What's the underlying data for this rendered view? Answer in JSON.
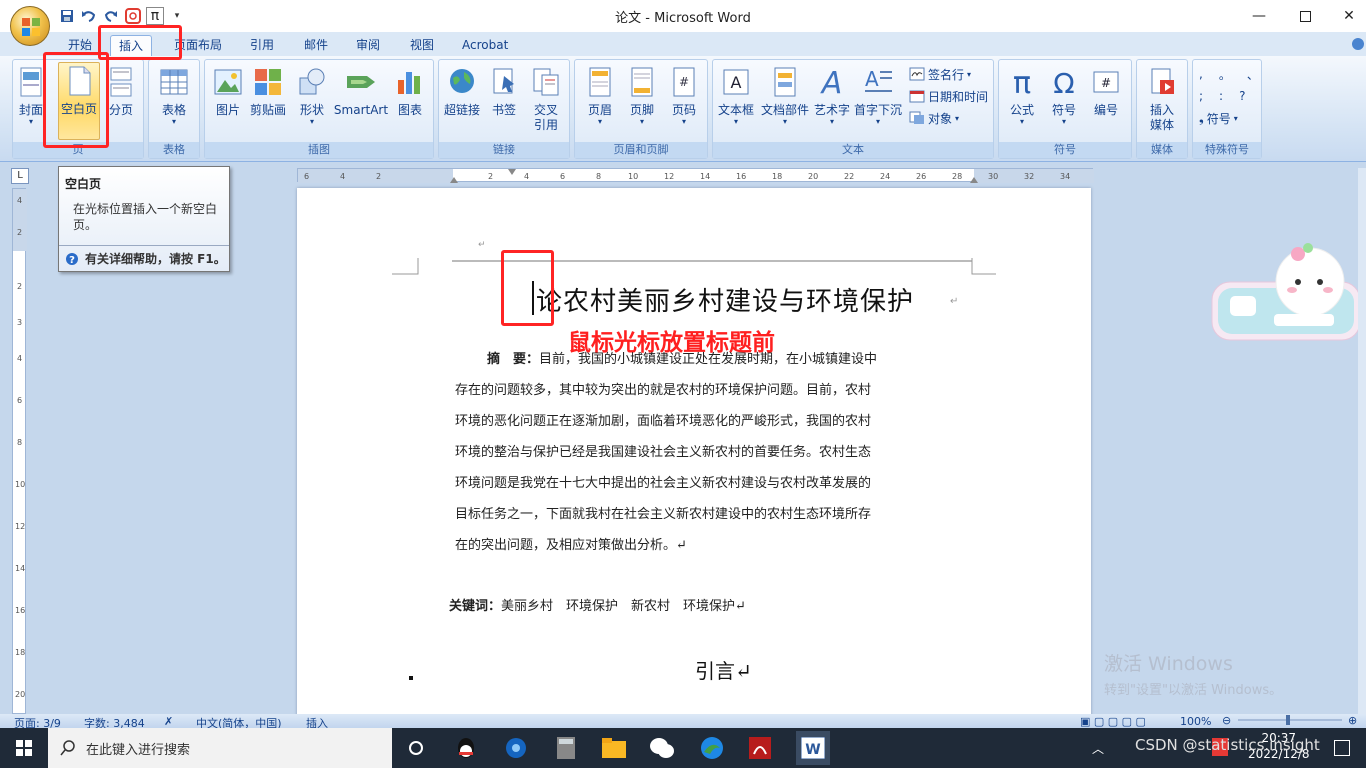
{
  "window": {
    "title": "论文 - Microsoft Word"
  },
  "tabs": [
    "开始",
    "插入",
    "页面布局",
    "引用",
    "邮件",
    "审阅",
    "视图",
    "Acrobat"
  ],
  "active_tab": "插入",
  "ribbon": {
    "page_group": {
      "label": "页",
      "cover": "封面",
      "blank": "空白页",
      "break": "分页"
    },
    "table_group": {
      "label": "表格",
      "table": "表格"
    },
    "illus_group": {
      "label": "插图",
      "picture": "图片",
      "clipart": "剪贴画",
      "shapes": "形状",
      "smartart": "SmartArt",
      "chart": "图表"
    },
    "links_group": {
      "label": "链接",
      "hyperlink": "超链接",
      "bookmark": "书签",
      "crossref": "交叉引用"
    },
    "hf_group": {
      "label": "页眉和页脚",
      "header": "页眉",
      "footer": "页脚",
      "pagenum": "页码"
    },
    "text_group": {
      "label": "文本",
      "textbox": "文本框",
      "quickparts": "文档部件",
      "wordart": "艺术字",
      "dropcap": "首字下沉",
      "sigline": "签名行",
      "datetime": "日期和时间",
      "object": "对象"
    },
    "symbols_group": {
      "label": "符号",
      "equation": "公式",
      "symbol": "符号",
      "number": "编号"
    },
    "media_group": {
      "label": "媒体",
      "insertmedia": "插入媒体"
    },
    "special_group": {
      "label": "特殊符号",
      "symbol_btn": "符号"
    }
  },
  "tooltip": {
    "title": "空白页",
    "desc": "在光标位置插入一个新空白页。",
    "foot": "有关详细帮助，请按 F1。"
  },
  "document": {
    "title": "论农村美丽乡村建设与环境保护",
    "annotation": "鼠标光标放置标题前",
    "abstract_label": "摘　要：",
    "abstract_lines": [
      "目前，我国的小城镇建设正处在发展时期，在小城镇建设中",
      "存在的问题较多，其中较为突出的就是农村的环境保护问题。目前，农村",
      "环境的恶化问题正在逐渐加剧，面临着环境恶化的严峻形式，我国的农村",
      "环境的整治与保护已经是我国建设社会主义新农村的首要任务。农村生态",
      "环境问题是我党在十七大中提出的社会主义新农村建设与农村改革发展的",
      "目标任务之一，下面就我村在社会主义新农村建设中的农村生态环境所存",
      "在的突出问题，及相应对策做出分析。↵"
    ],
    "keywords_label": "关键词：",
    "keywords": "美丽乡村　环境保护　新农村　环境保护↵",
    "intro": "引言↵"
  },
  "statusbar": {
    "page": "页面: 3/9",
    "words": "字数: 3,484",
    "lang": "中文(简体，中国)",
    "mode": "插入",
    "zoom": "100%"
  },
  "watermark": {
    "line1": "激活 Windows",
    "line2": "转到\"设置\"以激活 Windows。"
  },
  "taskbar": {
    "search_placeholder": "在此键入进行搜索",
    "csdn": "CSDN @statistics.insight",
    "time": "20:37",
    "date": "2022/12/8"
  }
}
